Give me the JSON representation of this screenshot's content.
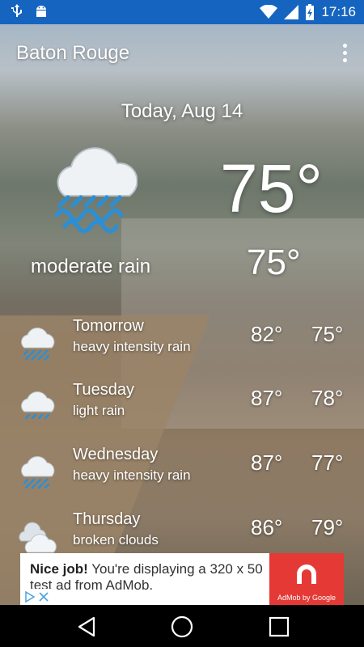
{
  "status_bar": {
    "time": "17:16",
    "bg_color": "#1565c0",
    "icons": [
      "usb-icon",
      "android-icon",
      "wifi-icon",
      "signal-icon",
      "battery-charging-icon"
    ]
  },
  "app_bar": {
    "title": "Baton Rouge",
    "menu_icon": "overflow-menu-icon"
  },
  "current": {
    "date": "Today, Aug 14",
    "temp_large": "75°",
    "temp_small": "75°",
    "condition": "moderate rain",
    "icon": "rain-cloud-icon"
  },
  "forecast": [
    {
      "day": "Tomorrow",
      "desc": "heavy intensity rain",
      "hi": "82°",
      "lo": "75°",
      "icon": "rain-cloud-icon"
    },
    {
      "day": "Tuesday",
      "desc": "light rain",
      "hi": "87°",
      "lo": "78°",
      "icon": "rain-cloud-icon"
    },
    {
      "day": "Wednesday",
      "desc": "heavy intensity rain",
      "hi": "87°",
      "lo": "77°",
      "icon": "rain-cloud-icon"
    },
    {
      "day": "Thursday",
      "desc": "broken clouds",
      "hi": "86°",
      "lo": "79°",
      "icon": "broken-clouds-icon"
    }
  ],
  "ad": {
    "bold": "Nice job!",
    "text": " You're displaying a 320 x 50 test ad from AdMob.",
    "brand_caption": "AdMob by Google",
    "brand_color": "#e53935"
  },
  "nav": {
    "back": "back-icon",
    "home": "home-icon",
    "recents": "recents-icon"
  }
}
